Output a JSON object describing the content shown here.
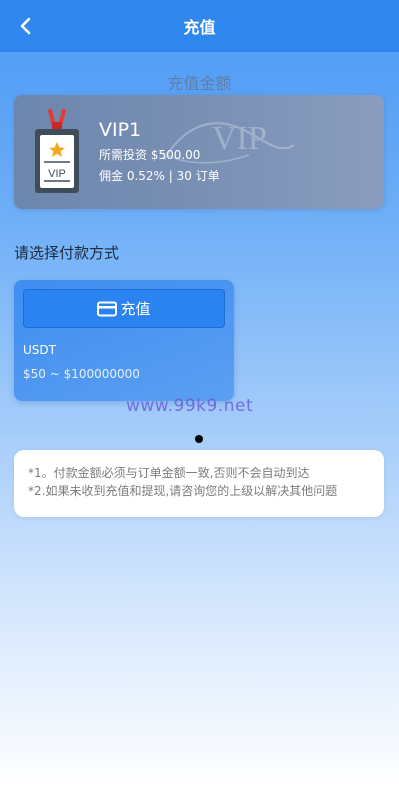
{
  "header": {
    "title": "充值",
    "back_icon": "chevron-left-icon"
  },
  "vip": {
    "caption": "充值金额",
    "name": "VIP1",
    "invest": "所需投资 $500.00",
    "commission": "佣金 0.52% | 30 订单",
    "badge_text": "VIP",
    "watermark_text": "VIP"
  },
  "payment": {
    "section_label": "请选择付款方式",
    "button_label": "充值",
    "button_icon": "card-icon",
    "method_name": "USDT",
    "range": "$50 ~ $100000000"
  },
  "watermark": "www.99k9.net",
  "notice": {
    "line1": "*1。付款金额必须与订单金额一致,否则不会自动到达",
    "line2": "*2.如果未收到充值和提现,请咨询您的上级以解决其他问题"
  },
  "colors": {
    "topbar": "#2f86ec",
    "vip_card": "#7c92b6",
    "pay_button": "#2b82f1"
  }
}
